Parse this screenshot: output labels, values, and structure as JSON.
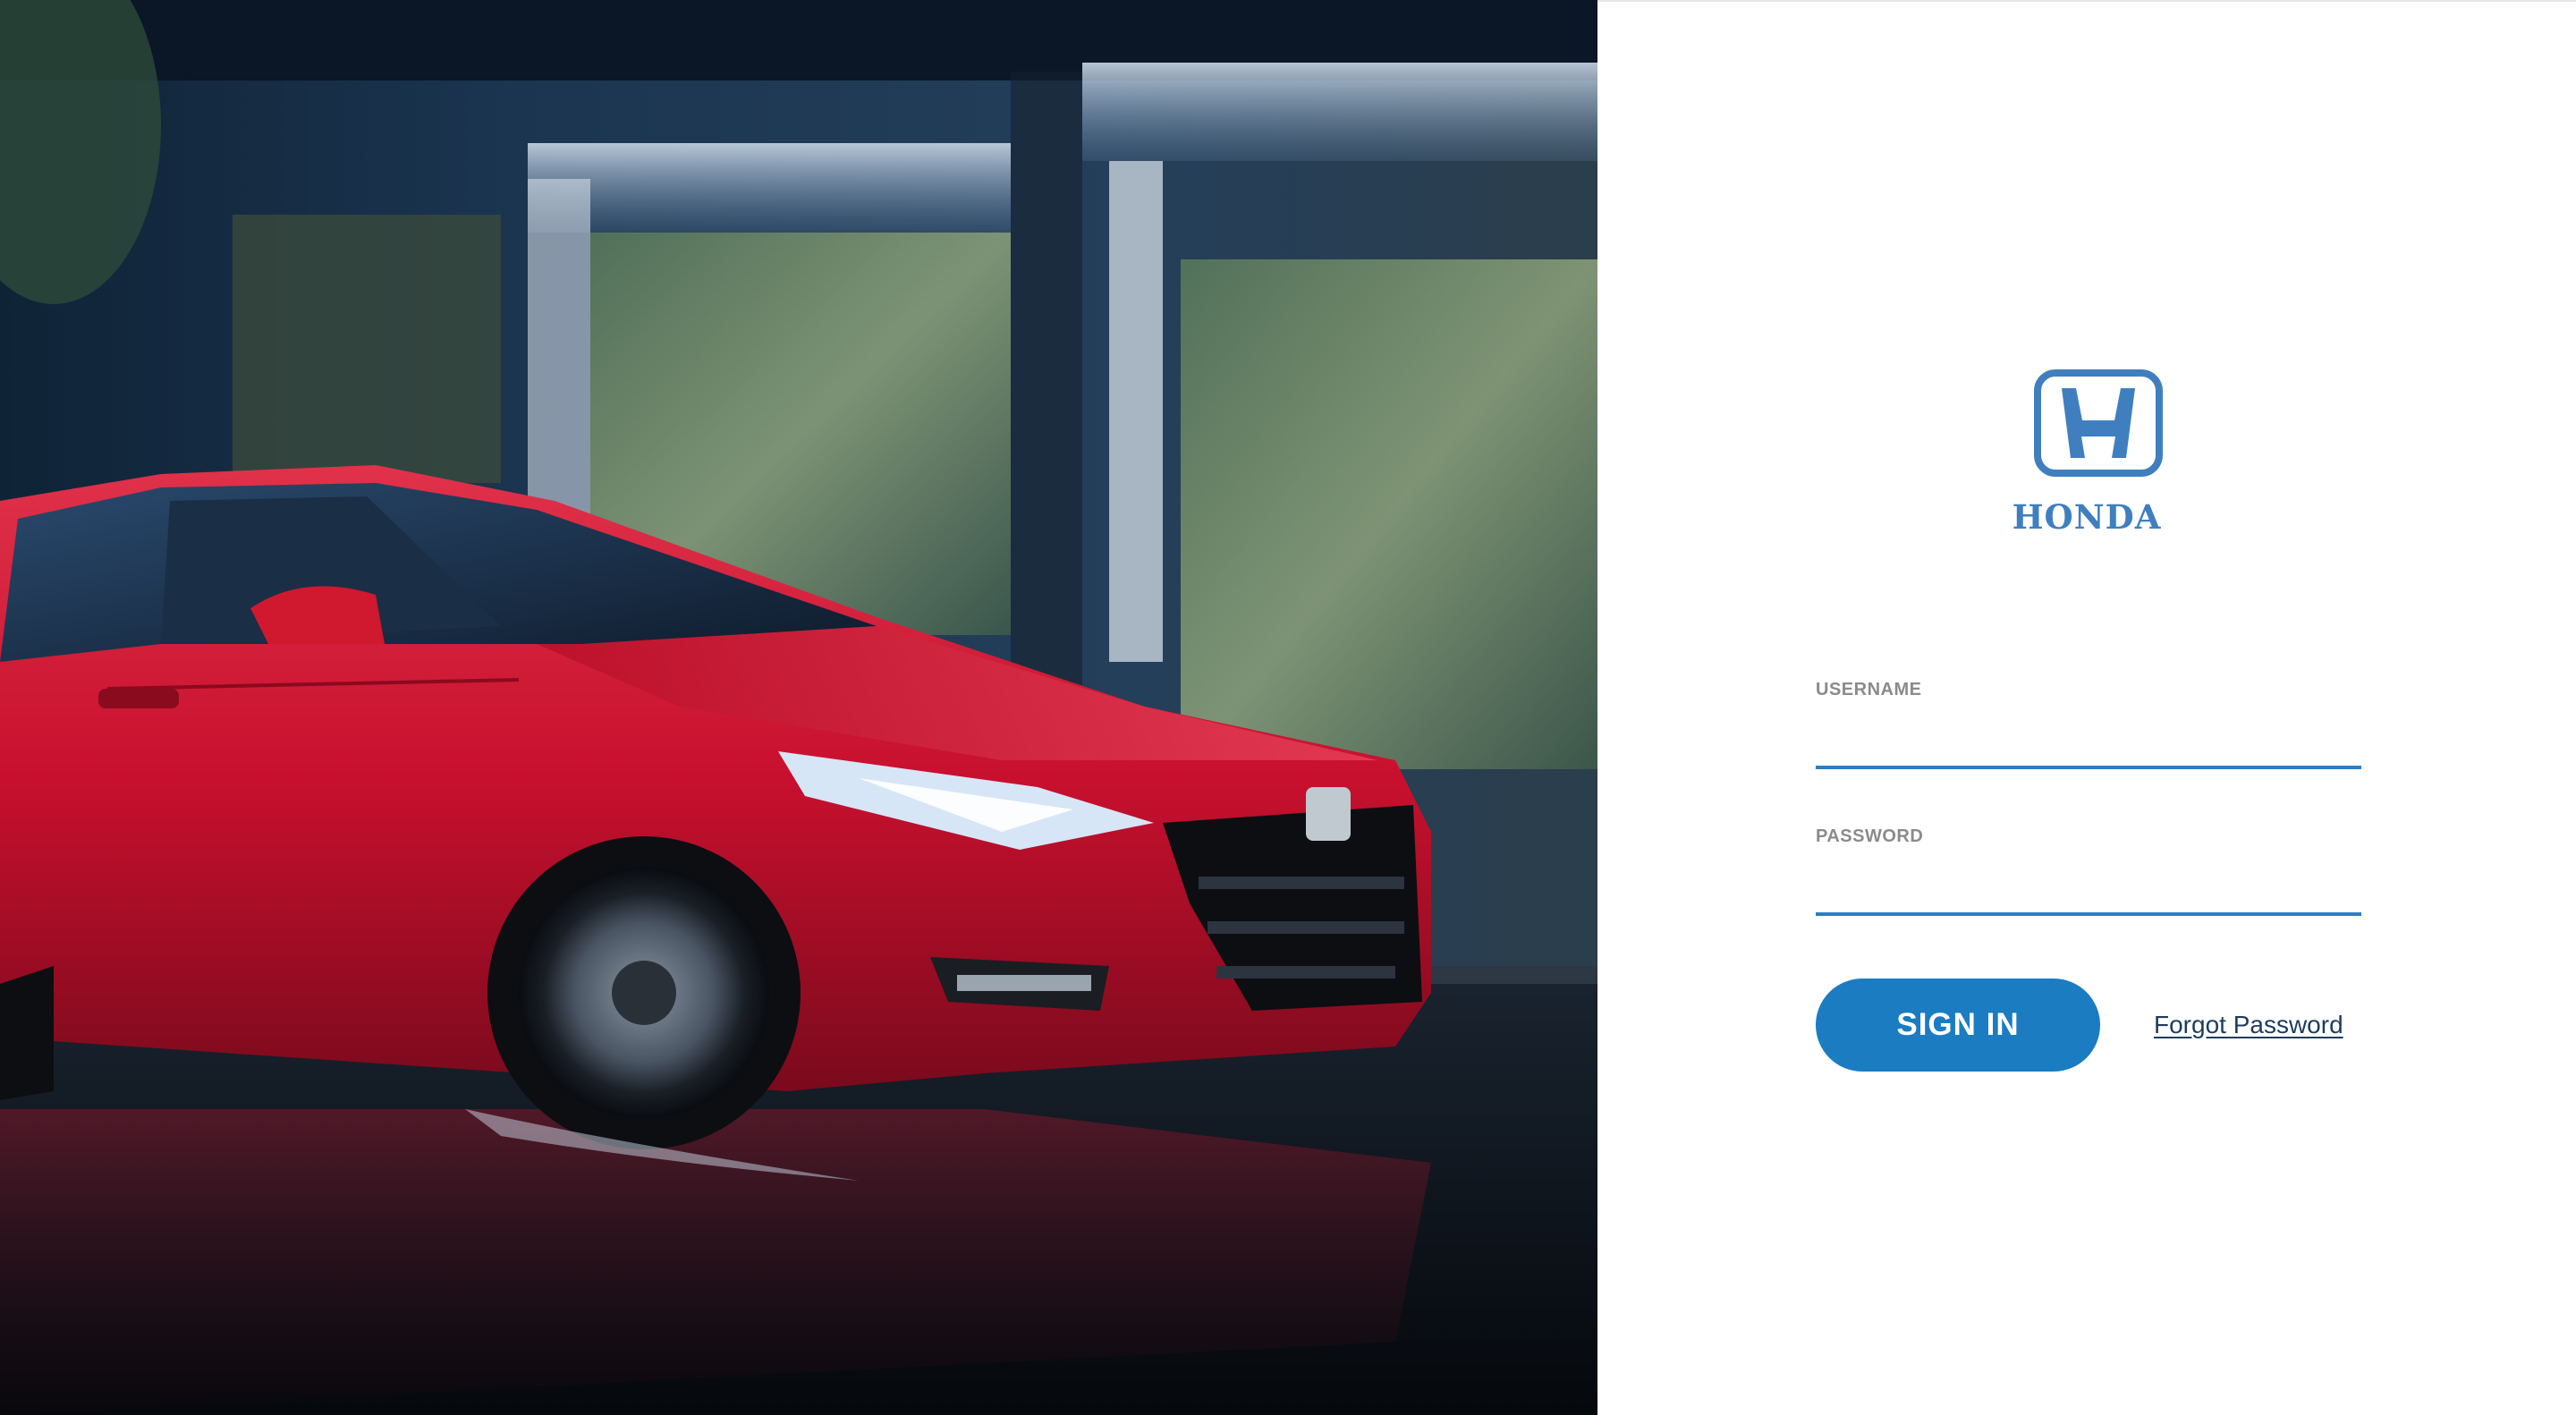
{
  "brand": {
    "name": "HONDA",
    "color": "#3f7fbf",
    "logo_icon": "honda-h-logo-icon"
  },
  "hero": {
    "image": "red-sedan-hero-image",
    "car_color": "#c8102e"
  },
  "login": {
    "username_label": "USERNAME",
    "username_value": "",
    "password_label": "PASSWORD",
    "password_value": "",
    "sign_in_label": "SIGN IN",
    "forgot_password_label": "Forgot Password",
    "accent_color": "#1b7cc2"
  }
}
